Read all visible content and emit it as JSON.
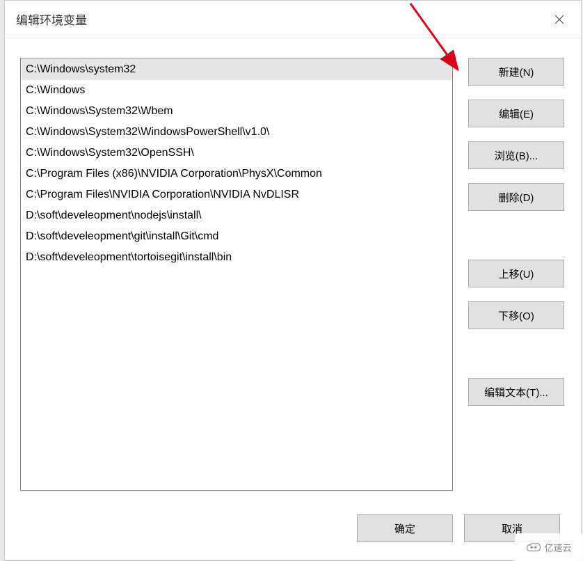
{
  "title": "编辑环境变量",
  "list": {
    "items": [
      "C:\\Windows\\system32",
      "C:\\Windows",
      "C:\\Windows\\System32\\Wbem",
      "C:\\Windows\\System32\\WindowsPowerShell\\v1.0\\",
      "C:\\Windows\\System32\\OpenSSH\\",
      "C:\\Program Files (x86)\\NVIDIA Corporation\\PhysX\\Common",
      "C:\\Program Files\\NVIDIA Corporation\\NVIDIA NvDLISR",
      "D:\\soft\\develeopment\\nodejs\\install\\",
      "D:\\soft\\develeopment\\git\\install\\Git\\cmd",
      "D:\\soft\\develeopment\\tortoisegit\\install\\bin"
    ],
    "selected_index": 0
  },
  "buttons": {
    "new": "新建(N)",
    "edit": "编辑(E)",
    "browse": "浏览(B)...",
    "delete": "删除(D)",
    "move_up": "上移(U)",
    "move_down": "下移(O)",
    "edit_text": "编辑文本(T)...",
    "ok": "确定",
    "cancel": "取消"
  },
  "watermark": "亿速云"
}
